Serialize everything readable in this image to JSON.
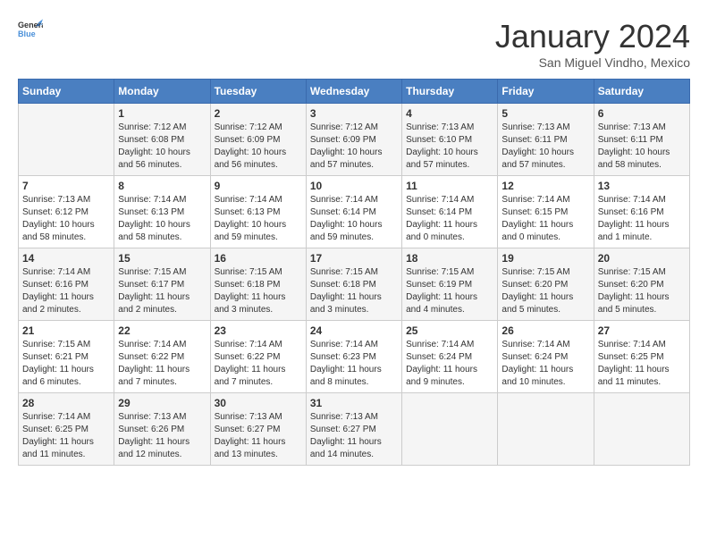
{
  "header": {
    "logo": {
      "line1": "General",
      "line2": "Blue"
    },
    "title": "January 2024",
    "subtitle": "San Miguel Vindho, Mexico"
  },
  "weekdays": [
    "Sunday",
    "Monday",
    "Tuesday",
    "Wednesday",
    "Thursday",
    "Friday",
    "Saturday"
  ],
  "weeks": [
    [
      {
        "day": "",
        "info": ""
      },
      {
        "day": "1",
        "info": "Sunrise: 7:12 AM\nSunset: 6:08 PM\nDaylight: 10 hours\nand 56 minutes."
      },
      {
        "day": "2",
        "info": "Sunrise: 7:12 AM\nSunset: 6:09 PM\nDaylight: 10 hours\nand 56 minutes."
      },
      {
        "day": "3",
        "info": "Sunrise: 7:12 AM\nSunset: 6:09 PM\nDaylight: 10 hours\nand 57 minutes."
      },
      {
        "day": "4",
        "info": "Sunrise: 7:13 AM\nSunset: 6:10 PM\nDaylight: 10 hours\nand 57 minutes."
      },
      {
        "day": "5",
        "info": "Sunrise: 7:13 AM\nSunset: 6:11 PM\nDaylight: 10 hours\nand 57 minutes."
      },
      {
        "day": "6",
        "info": "Sunrise: 7:13 AM\nSunset: 6:11 PM\nDaylight: 10 hours\nand 58 minutes."
      }
    ],
    [
      {
        "day": "7",
        "info": "Sunrise: 7:13 AM\nSunset: 6:12 PM\nDaylight: 10 hours\nand 58 minutes."
      },
      {
        "day": "8",
        "info": "Sunrise: 7:14 AM\nSunset: 6:13 PM\nDaylight: 10 hours\nand 58 minutes."
      },
      {
        "day": "9",
        "info": "Sunrise: 7:14 AM\nSunset: 6:13 PM\nDaylight: 10 hours\nand 59 minutes."
      },
      {
        "day": "10",
        "info": "Sunrise: 7:14 AM\nSunset: 6:14 PM\nDaylight: 10 hours\nand 59 minutes."
      },
      {
        "day": "11",
        "info": "Sunrise: 7:14 AM\nSunset: 6:14 PM\nDaylight: 11 hours\nand 0 minutes."
      },
      {
        "day": "12",
        "info": "Sunrise: 7:14 AM\nSunset: 6:15 PM\nDaylight: 11 hours\nand 0 minutes."
      },
      {
        "day": "13",
        "info": "Sunrise: 7:14 AM\nSunset: 6:16 PM\nDaylight: 11 hours\nand 1 minute."
      }
    ],
    [
      {
        "day": "14",
        "info": "Sunrise: 7:14 AM\nSunset: 6:16 PM\nDaylight: 11 hours\nand 2 minutes."
      },
      {
        "day": "15",
        "info": "Sunrise: 7:15 AM\nSunset: 6:17 PM\nDaylight: 11 hours\nand 2 minutes."
      },
      {
        "day": "16",
        "info": "Sunrise: 7:15 AM\nSunset: 6:18 PM\nDaylight: 11 hours\nand 3 minutes."
      },
      {
        "day": "17",
        "info": "Sunrise: 7:15 AM\nSunset: 6:18 PM\nDaylight: 11 hours\nand 3 minutes."
      },
      {
        "day": "18",
        "info": "Sunrise: 7:15 AM\nSunset: 6:19 PM\nDaylight: 11 hours\nand 4 minutes."
      },
      {
        "day": "19",
        "info": "Sunrise: 7:15 AM\nSunset: 6:20 PM\nDaylight: 11 hours\nand 5 minutes."
      },
      {
        "day": "20",
        "info": "Sunrise: 7:15 AM\nSunset: 6:20 PM\nDaylight: 11 hours\nand 5 minutes."
      }
    ],
    [
      {
        "day": "21",
        "info": "Sunrise: 7:15 AM\nSunset: 6:21 PM\nDaylight: 11 hours\nand 6 minutes."
      },
      {
        "day": "22",
        "info": "Sunrise: 7:14 AM\nSunset: 6:22 PM\nDaylight: 11 hours\nand 7 minutes."
      },
      {
        "day": "23",
        "info": "Sunrise: 7:14 AM\nSunset: 6:22 PM\nDaylight: 11 hours\nand 7 minutes."
      },
      {
        "day": "24",
        "info": "Sunrise: 7:14 AM\nSunset: 6:23 PM\nDaylight: 11 hours\nand 8 minutes."
      },
      {
        "day": "25",
        "info": "Sunrise: 7:14 AM\nSunset: 6:24 PM\nDaylight: 11 hours\nand 9 minutes."
      },
      {
        "day": "26",
        "info": "Sunrise: 7:14 AM\nSunset: 6:24 PM\nDaylight: 11 hours\nand 10 minutes."
      },
      {
        "day": "27",
        "info": "Sunrise: 7:14 AM\nSunset: 6:25 PM\nDaylight: 11 hours\nand 11 minutes."
      }
    ],
    [
      {
        "day": "28",
        "info": "Sunrise: 7:14 AM\nSunset: 6:25 PM\nDaylight: 11 hours\nand 11 minutes."
      },
      {
        "day": "29",
        "info": "Sunrise: 7:13 AM\nSunset: 6:26 PM\nDaylight: 11 hours\nand 12 minutes."
      },
      {
        "day": "30",
        "info": "Sunrise: 7:13 AM\nSunset: 6:27 PM\nDaylight: 11 hours\nand 13 minutes."
      },
      {
        "day": "31",
        "info": "Sunrise: 7:13 AM\nSunset: 6:27 PM\nDaylight: 11 hours\nand 14 minutes."
      },
      {
        "day": "",
        "info": ""
      },
      {
        "day": "",
        "info": ""
      },
      {
        "day": "",
        "info": ""
      }
    ]
  ]
}
